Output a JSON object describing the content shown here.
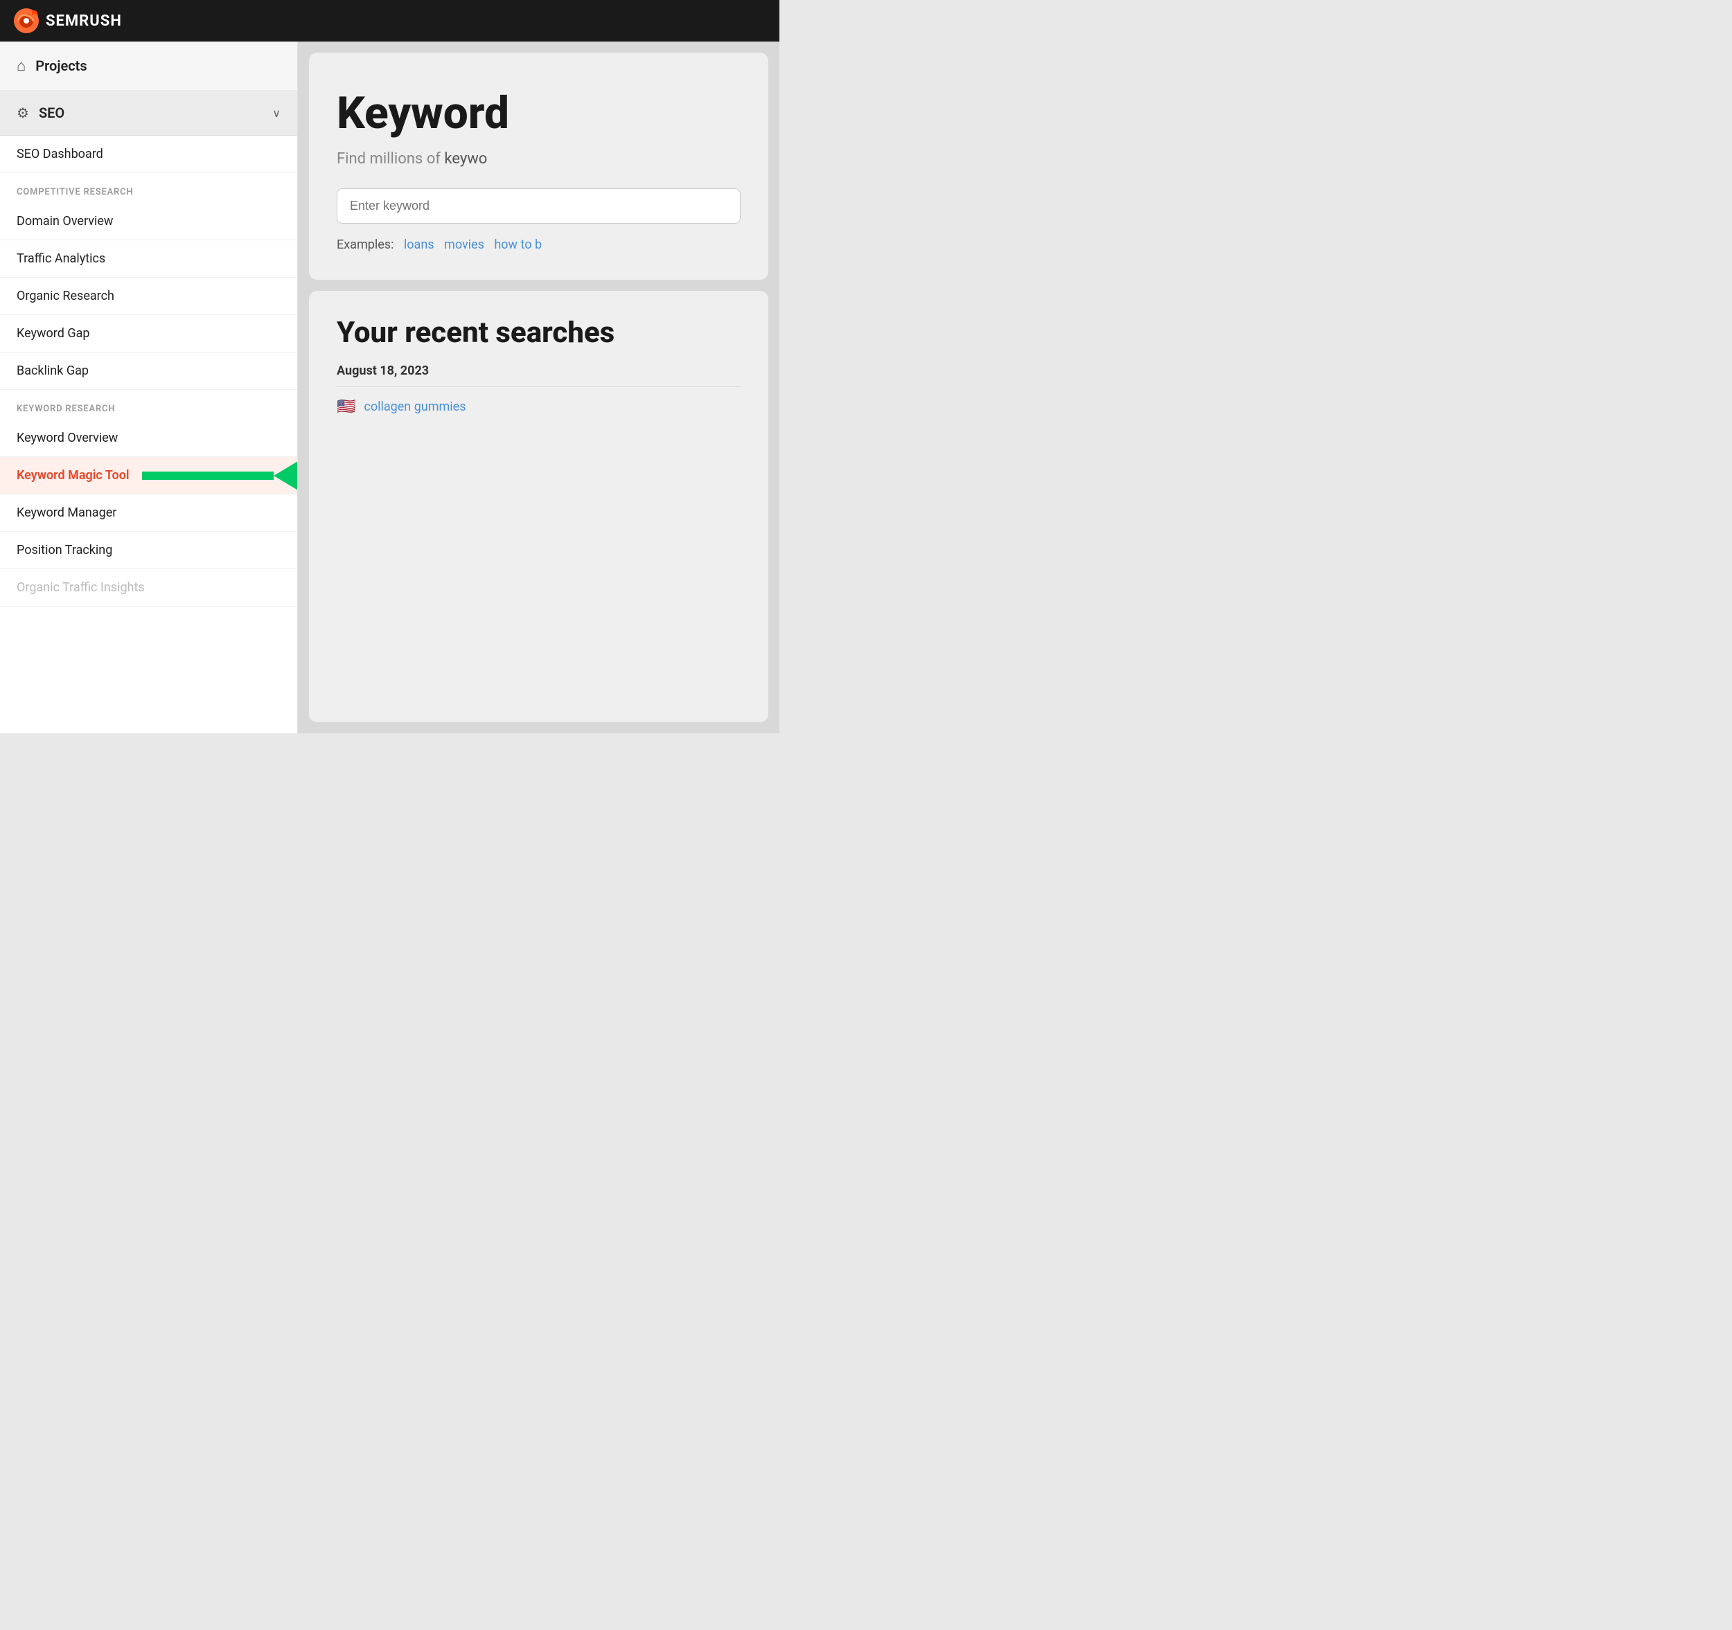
{
  "topbar": {
    "logo_text": "SEMRUSH"
  },
  "sidebar": {
    "projects_label": "Projects",
    "seo_label": "SEO",
    "seo_dashboard": "SEO Dashboard",
    "sections": [
      {
        "label": "COMPETITIVE RESEARCH",
        "items": [
          {
            "id": "domain-overview",
            "text": "Domain Overview",
            "active": false,
            "disabled": false
          },
          {
            "id": "traffic-analytics",
            "text": "Traffic Analytics",
            "active": false,
            "disabled": false
          },
          {
            "id": "organic-research",
            "text": "Organic Research",
            "active": false,
            "disabled": false
          },
          {
            "id": "keyword-gap",
            "text": "Keyword Gap",
            "active": false,
            "disabled": false
          },
          {
            "id": "backlink-gap",
            "text": "Backlink Gap",
            "active": false,
            "disabled": false
          }
        ]
      },
      {
        "label": "KEYWORD RESEARCH",
        "items": [
          {
            "id": "keyword-overview",
            "text": "Keyword Overview",
            "active": false,
            "disabled": false
          },
          {
            "id": "keyword-magic-tool",
            "text": "Keyword Magic Tool",
            "active": true,
            "disabled": false
          },
          {
            "id": "keyword-manager",
            "text": "Keyword Manager",
            "active": false,
            "disabled": false
          },
          {
            "id": "position-tracking",
            "text": "Position Tracking",
            "active": false,
            "disabled": false
          },
          {
            "id": "organic-traffic-insights",
            "text": "Organic Traffic Insights",
            "active": false,
            "disabled": true
          }
        ]
      }
    ]
  },
  "content": {
    "keyword_tool": {
      "title": "Keyword",
      "subtitle_text": "Find millions of",
      "subtitle_partial": "keywo",
      "input_placeholder": "Enter keyword",
      "examples_label": "Examples:",
      "examples": [
        "loans",
        "movies",
        "how to b"
      ]
    },
    "recent": {
      "title": "Your recent searche",
      "title_suffix": "s",
      "date": "August 18, 2023",
      "items": [
        {
          "flag": "🇺🇸",
          "text": "collagen gummies"
        }
      ]
    }
  }
}
